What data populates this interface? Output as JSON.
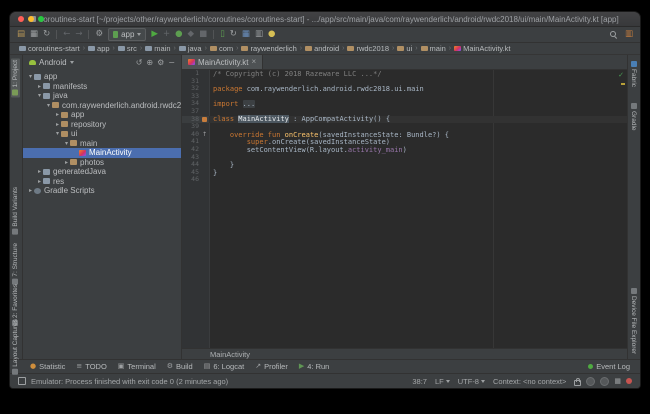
{
  "titlebar": {
    "title": "coroutines-start [~/projects/other/raywenderlich/coroutines/coroutines-start] - .../app/src/main/java/com/raywenderlich/android/rwdc2018/ui/main/MainActivity.kt [app]"
  },
  "toolbar": {
    "items": [
      {
        "name": "open-project-icon",
        "glyph": "▤",
        "color": "#b99757"
      },
      {
        "name": "save-all-icon",
        "glyph": "▦",
        "color": "#9da0a2"
      },
      {
        "name": "sync-project-icon",
        "glyph": "↻",
        "color": "#9da0a2"
      },
      {
        "name": "separator"
      },
      {
        "name": "back-icon",
        "glyph": "←",
        "color": "#63666a"
      },
      {
        "name": "forward-icon",
        "glyph": "→",
        "color": "#63666a"
      },
      {
        "name": "separator"
      },
      {
        "name": "wrench-icon",
        "glyph": "⚙",
        "color": "#9da0a2"
      },
      {
        "name": "run-config-selector",
        "label": "app"
      },
      {
        "name": "run-icon",
        "glyph": "▶",
        "color": "#4faa41"
      },
      {
        "name": "apply-changes-icon",
        "glyph": "+",
        "color": "#63666a"
      },
      {
        "name": "debug-icon",
        "glyph": "●",
        "color": "#5d9e50"
      },
      {
        "name": "profile-icon",
        "glyph": "◆",
        "color": "#63666a"
      },
      {
        "name": "stop-icon",
        "glyph": "■",
        "color": "#63666a"
      },
      {
        "name": "separator"
      },
      {
        "name": "avd-manager-icon",
        "glyph": "▯",
        "color": "#5d9e50"
      },
      {
        "name": "gradle-sync-icon",
        "glyph": "↻",
        "color": "#9da0a2"
      },
      {
        "name": "sdk-manager-icon",
        "glyph": "▦",
        "color": "#6a8fbf"
      },
      {
        "name": "layout-inspector-icon",
        "glyph": "▥",
        "color": "#9da0a2"
      },
      {
        "name": "bulb-icon",
        "glyph": "●",
        "color": "#d6bf55"
      }
    ],
    "right": {
      "structure_glyph": "▥"
    }
  },
  "navbar": {
    "crumbs": [
      {
        "label": "coroutines-start",
        "icon": "module"
      },
      {
        "label": "app",
        "icon": "module"
      },
      {
        "label": "src",
        "icon": "folder"
      },
      {
        "label": "main",
        "icon": "folder"
      },
      {
        "label": "java",
        "icon": "folder"
      },
      {
        "label": "com",
        "icon": "package"
      },
      {
        "label": "raywenderlich",
        "icon": "package"
      },
      {
        "label": "android",
        "icon": "package"
      },
      {
        "label": "rwdc2018",
        "icon": "package"
      },
      {
        "label": "ui",
        "icon": "package"
      },
      {
        "label": "main",
        "icon": "package"
      },
      {
        "label": "MainActivity.kt",
        "icon": "kotlin"
      }
    ]
  },
  "left_stripe": {
    "top": [
      {
        "label": "1: Project",
        "icon": "green",
        "active": true
      }
    ],
    "bottom": [
      {
        "label": "Build Variants",
        "icon": "gray"
      },
      {
        "label": "7: Structure",
        "icon": "gray"
      },
      {
        "label": "2: Favorites",
        "icon": "gray"
      },
      {
        "label": "Layout Captures",
        "icon": "gray"
      }
    ]
  },
  "right_stripe": {
    "top": [
      {
        "label": "Fabric",
        "icon": "blue"
      },
      {
        "label": "Gradle",
        "icon": "gray"
      }
    ],
    "bottom": [
      {
        "label": "Device File Explorer",
        "icon": "gray"
      }
    ]
  },
  "project": {
    "selector": "Android",
    "header_icons": [
      {
        "name": "sync-view-icon",
        "glyph": "↺"
      },
      {
        "name": "locate-file-icon",
        "glyph": "⊕"
      },
      {
        "name": "settings-icon",
        "glyph": "⚙"
      },
      {
        "name": "hide-panel-icon",
        "glyph": "−"
      }
    ],
    "tree": [
      {
        "label": "app",
        "depth": 0,
        "exp": "open",
        "icon": "module"
      },
      {
        "label": "manifests",
        "depth": 1,
        "exp": "closed",
        "icon": "folder"
      },
      {
        "label": "java",
        "depth": 1,
        "exp": "open",
        "icon": "folder"
      },
      {
        "label": "com.raywenderlich.android.rwdc2018",
        "depth": 2,
        "exp": "open",
        "icon": "package"
      },
      {
        "label": "app",
        "depth": 3,
        "exp": "closed",
        "icon": "package"
      },
      {
        "label": "repository",
        "depth": 3,
        "exp": "closed",
        "icon": "package"
      },
      {
        "label": "ui",
        "depth": 3,
        "exp": "open",
        "icon": "package"
      },
      {
        "label": "main",
        "depth": 4,
        "exp": "open",
        "icon": "package"
      },
      {
        "label": "MainActivity",
        "depth": 5,
        "exp": "leaf",
        "icon": "kotlin",
        "selected": true
      },
      {
        "label": "photos",
        "depth": 4,
        "exp": "closed",
        "icon": "package"
      },
      {
        "label": "generatedJava",
        "depth": 1,
        "exp": "closed",
        "icon": "folder-gen"
      },
      {
        "label": "res",
        "depth": 1,
        "exp": "closed",
        "icon": "folder-res"
      },
      {
        "label": "Gradle Scripts",
        "depth": 0,
        "exp": "closed",
        "icon": "gradle"
      }
    ]
  },
  "editor": {
    "tab": "MainActivity.kt",
    "breadcrumb": "MainActivity",
    "lines": [
      {
        "n": "1",
        "seg": [
          {
            "t": "/* Copyright (c) 2018 Razeware LLC ...*/",
            "c": "cm"
          }
        ]
      },
      {
        "n": "31",
        "seg": []
      },
      {
        "n": "32",
        "seg": [
          {
            "t": "package ",
            "c": "kw"
          },
          {
            "t": "com.raywenderlich.android.rwdc2018.ui.main",
            "c": "pl"
          }
        ]
      },
      {
        "n": "33",
        "seg": []
      },
      {
        "n": "34",
        "seg": [
          {
            "t": "import ",
            "c": "kw"
          },
          {
            "t": "...",
            "c": "fold"
          }
        ]
      },
      {
        "n": "37",
        "seg": []
      },
      {
        "n": "38",
        "caret": true,
        "gutter": "class",
        "seg": [
          {
            "t": "class ",
            "c": "kw"
          },
          {
            "t": "MainActivity",
            "c": "hl"
          },
          {
            "t": " : ",
            "c": "pl"
          },
          {
            "t": "AppCompatActivity() {",
            "c": "pl"
          }
        ]
      },
      {
        "n": "39",
        "seg": []
      },
      {
        "n": "40",
        "gutter": "override",
        "seg": [
          {
            "t": "    ",
            "c": "pl"
          },
          {
            "t": "override fun ",
            "c": "kw"
          },
          {
            "t": "onCreate",
            "c": "fn"
          },
          {
            "t": "(savedInstanceState: Bundle?) {",
            "c": "pl"
          }
        ]
      },
      {
        "n": "41",
        "seg": [
          {
            "t": "        ",
            "c": "pl"
          },
          {
            "t": "super",
            "c": "kw"
          },
          {
            "t": ".onCreate(savedInstanceState)",
            "c": "pl"
          }
        ]
      },
      {
        "n": "42",
        "seg": [
          {
            "t": "        setContentView(R.layout.",
            "c": "pl"
          },
          {
            "t": "activity_main",
            "c": "fld"
          },
          {
            "t": ")",
            "c": "pl"
          }
        ]
      },
      {
        "n": "43",
        "seg": []
      },
      {
        "n": "44",
        "seg": [
          {
            "t": "    }",
            "c": "pl"
          }
        ]
      },
      {
        "n": "45",
        "seg": [
          {
            "t": "}",
            "c": "pl"
          }
        ]
      },
      {
        "n": "46",
        "seg": []
      }
    ]
  },
  "bottom_bar": {
    "left": [
      {
        "label": "Statistic",
        "icon": "statistic-icon",
        "glyph": "●",
        "color": "#cf8e3c"
      },
      {
        "label": "TODO",
        "icon": "todo-icon",
        "glyph": "≡",
        "color": "#9da0a2"
      },
      {
        "label": "Terminal",
        "icon": "terminal-icon",
        "glyph": "▣",
        "color": "#9da0a2"
      },
      {
        "label": "Build",
        "icon": "build-icon",
        "glyph": "⚙",
        "color": "#9da0a2"
      },
      {
        "label": "6: Logcat",
        "icon": "logcat-icon",
        "glyph": "▤",
        "color": "#9da0a2"
      },
      {
        "label": "Profiler",
        "icon": "profiler-icon",
        "glyph": "↗",
        "color": "#9da0a2"
      },
      {
        "label": "4: Run",
        "icon": "run-toolwindow-icon",
        "glyph": "▶",
        "color": "#5f9654"
      }
    ],
    "right": [
      {
        "label": "Event Log",
        "icon": "event-log-icon"
      }
    ]
  },
  "status_bar": {
    "message": "Emulator: Process finished with exit code 0 (2 minutes ago)",
    "position": "38:7",
    "line_sep": "LF",
    "encoding": "UTF-8",
    "context": "Context: <no context>",
    "icons": [
      "unlocked-icon",
      "background-task-icon",
      "background-task-icon-2",
      "grid-icon",
      "notification-dot-icon"
    ]
  }
}
